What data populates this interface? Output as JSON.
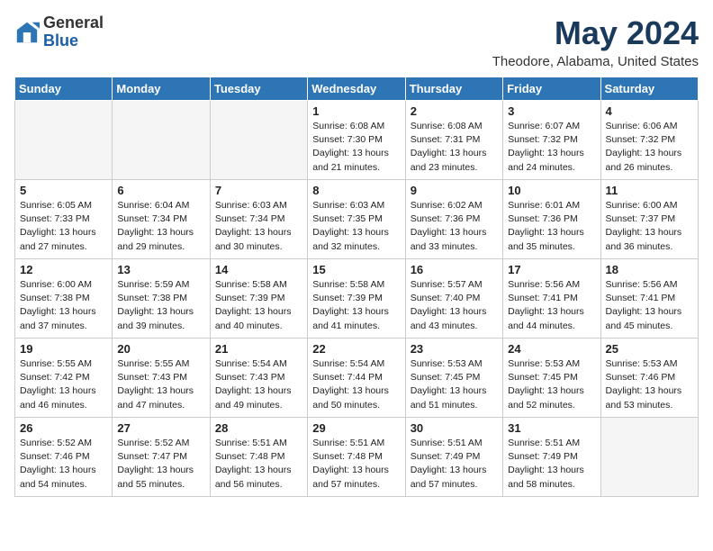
{
  "logo": {
    "general": "General",
    "blue": "Blue"
  },
  "title": "May 2024",
  "location": "Theodore, Alabama, United States",
  "days_header": [
    "Sunday",
    "Monday",
    "Tuesday",
    "Wednesday",
    "Thursday",
    "Friday",
    "Saturday"
  ],
  "weeks": [
    [
      {
        "day": "",
        "info": ""
      },
      {
        "day": "",
        "info": ""
      },
      {
        "day": "",
        "info": ""
      },
      {
        "day": "1",
        "info": "Sunrise: 6:08 AM\nSunset: 7:30 PM\nDaylight: 13 hours\nand 21 minutes."
      },
      {
        "day": "2",
        "info": "Sunrise: 6:08 AM\nSunset: 7:31 PM\nDaylight: 13 hours\nand 23 minutes."
      },
      {
        "day": "3",
        "info": "Sunrise: 6:07 AM\nSunset: 7:32 PM\nDaylight: 13 hours\nand 24 minutes."
      },
      {
        "day": "4",
        "info": "Sunrise: 6:06 AM\nSunset: 7:32 PM\nDaylight: 13 hours\nand 26 minutes."
      }
    ],
    [
      {
        "day": "5",
        "info": "Sunrise: 6:05 AM\nSunset: 7:33 PM\nDaylight: 13 hours\nand 27 minutes."
      },
      {
        "day": "6",
        "info": "Sunrise: 6:04 AM\nSunset: 7:34 PM\nDaylight: 13 hours\nand 29 minutes."
      },
      {
        "day": "7",
        "info": "Sunrise: 6:03 AM\nSunset: 7:34 PM\nDaylight: 13 hours\nand 30 minutes."
      },
      {
        "day": "8",
        "info": "Sunrise: 6:03 AM\nSunset: 7:35 PM\nDaylight: 13 hours\nand 32 minutes."
      },
      {
        "day": "9",
        "info": "Sunrise: 6:02 AM\nSunset: 7:36 PM\nDaylight: 13 hours\nand 33 minutes."
      },
      {
        "day": "10",
        "info": "Sunrise: 6:01 AM\nSunset: 7:36 PM\nDaylight: 13 hours\nand 35 minutes."
      },
      {
        "day": "11",
        "info": "Sunrise: 6:00 AM\nSunset: 7:37 PM\nDaylight: 13 hours\nand 36 minutes."
      }
    ],
    [
      {
        "day": "12",
        "info": "Sunrise: 6:00 AM\nSunset: 7:38 PM\nDaylight: 13 hours\nand 37 minutes."
      },
      {
        "day": "13",
        "info": "Sunrise: 5:59 AM\nSunset: 7:38 PM\nDaylight: 13 hours\nand 39 minutes."
      },
      {
        "day": "14",
        "info": "Sunrise: 5:58 AM\nSunset: 7:39 PM\nDaylight: 13 hours\nand 40 minutes."
      },
      {
        "day": "15",
        "info": "Sunrise: 5:58 AM\nSunset: 7:39 PM\nDaylight: 13 hours\nand 41 minutes."
      },
      {
        "day": "16",
        "info": "Sunrise: 5:57 AM\nSunset: 7:40 PM\nDaylight: 13 hours\nand 43 minutes."
      },
      {
        "day": "17",
        "info": "Sunrise: 5:56 AM\nSunset: 7:41 PM\nDaylight: 13 hours\nand 44 minutes."
      },
      {
        "day": "18",
        "info": "Sunrise: 5:56 AM\nSunset: 7:41 PM\nDaylight: 13 hours\nand 45 minutes."
      }
    ],
    [
      {
        "day": "19",
        "info": "Sunrise: 5:55 AM\nSunset: 7:42 PM\nDaylight: 13 hours\nand 46 minutes."
      },
      {
        "day": "20",
        "info": "Sunrise: 5:55 AM\nSunset: 7:43 PM\nDaylight: 13 hours\nand 47 minutes."
      },
      {
        "day": "21",
        "info": "Sunrise: 5:54 AM\nSunset: 7:43 PM\nDaylight: 13 hours\nand 49 minutes."
      },
      {
        "day": "22",
        "info": "Sunrise: 5:54 AM\nSunset: 7:44 PM\nDaylight: 13 hours\nand 50 minutes."
      },
      {
        "day": "23",
        "info": "Sunrise: 5:53 AM\nSunset: 7:45 PM\nDaylight: 13 hours\nand 51 minutes."
      },
      {
        "day": "24",
        "info": "Sunrise: 5:53 AM\nSunset: 7:45 PM\nDaylight: 13 hours\nand 52 minutes."
      },
      {
        "day": "25",
        "info": "Sunrise: 5:53 AM\nSunset: 7:46 PM\nDaylight: 13 hours\nand 53 minutes."
      }
    ],
    [
      {
        "day": "26",
        "info": "Sunrise: 5:52 AM\nSunset: 7:46 PM\nDaylight: 13 hours\nand 54 minutes."
      },
      {
        "day": "27",
        "info": "Sunrise: 5:52 AM\nSunset: 7:47 PM\nDaylight: 13 hours\nand 55 minutes."
      },
      {
        "day": "28",
        "info": "Sunrise: 5:51 AM\nSunset: 7:48 PM\nDaylight: 13 hours\nand 56 minutes."
      },
      {
        "day": "29",
        "info": "Sunrise: 5:51 AM\nSunset: 7:48 PM\nDaylight: 13 hours\nand 57 minutes."
      },
      {
        "day": "30",
        "info": "Sunrise: 5:51 AM\nSunset: 7:49 PM\nDaylight: 13 hours\nand 57 minutes."
      },
      {
        "day": "31",
        "info": "Sunrise: 5:51 AM\nSunset: 7:49 PM\nDaylight: 13 hours\nand 58 minutes."
      },
      {
        "day": "",
        "info": ""
      }
    ]
  ]
}
